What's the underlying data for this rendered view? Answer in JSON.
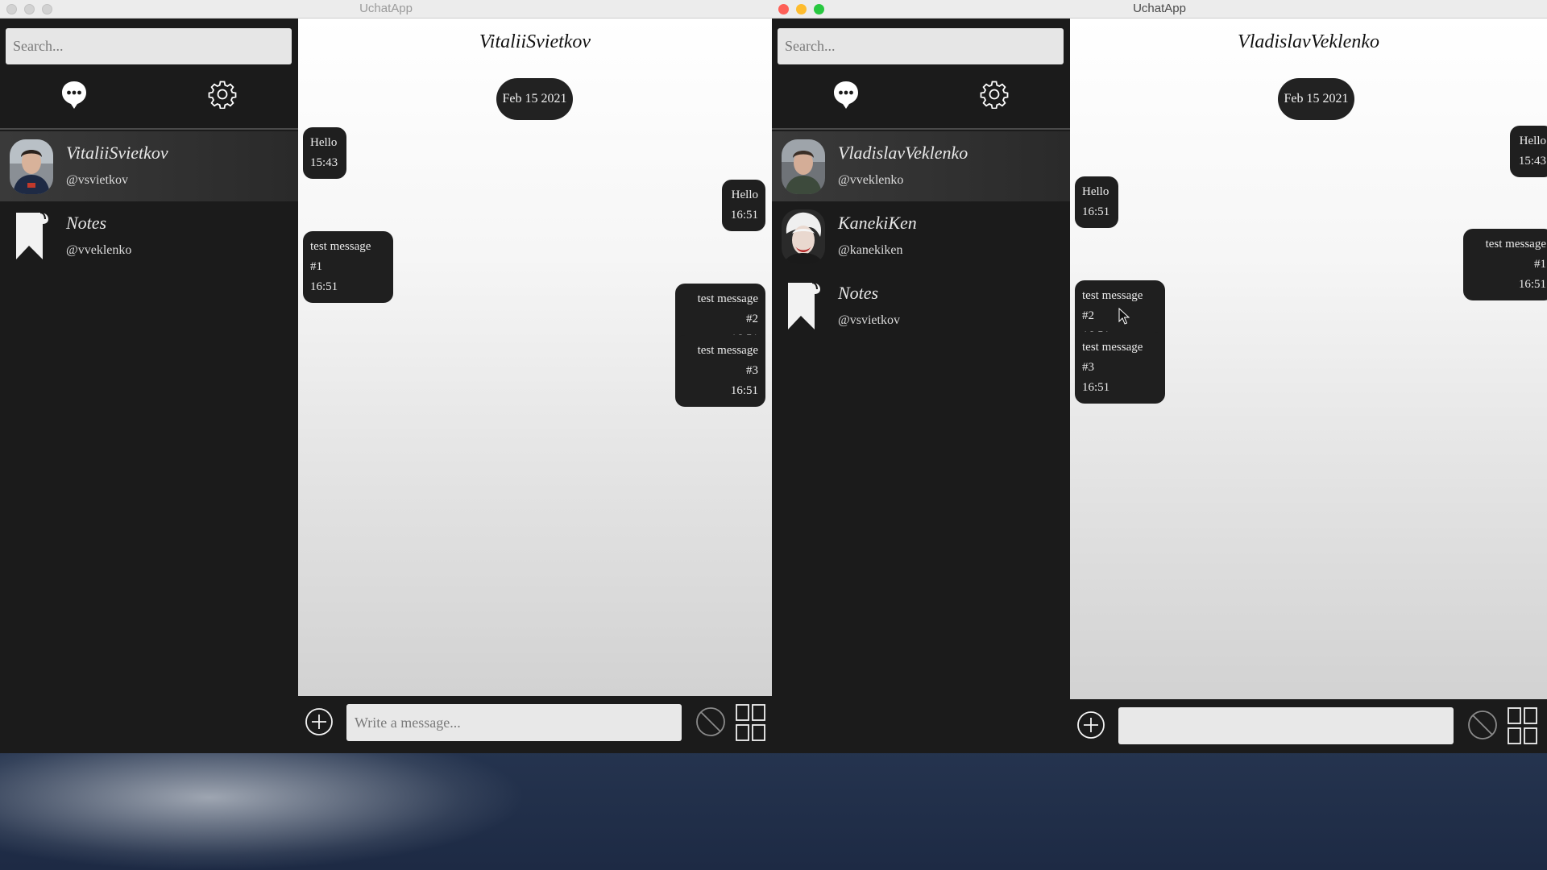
{
  "app": {
    "title": "UchatApp"
  },
  "left_window": {
    "search_placeholder": "Search...",
    "contacts": [
      {
        "name": "VitaliiSvietkov",
        "handle": "@vsvietkov",
        "avatar": "person-avatar-1"
      },
      {
        "name": "Notes",
        "handle": "@vveklenko",
        "avatar": "bookmark-icon"
      }
    ],
    "chat_title": "VitaliiSvietkov",
    "date": "Feb 15 2021",
    "messages": [
      {
        "text": "Hello",
        "time": "15:43",
        "dir": "in"
      },
      {
        "text": "Hello",
        "time": "16:51",
        "dir": "out"
      },
      {
        "text": "test message #1",
        "time": "16:51",
        "dir": "in"
      },
      {
        "text": "test message #2",
        "time": "16:51",
        "dir": "out"
      },
      {
        "text": "test message #3",
        "time": "16:51",
        "dir": "out"
      }
    ],
    "composer_placeholder": "Write a message...",
    "composer_value": ""
  },
  "right_window": {
    "search_placeholder": "Search...",
    "contacts": [
      {
        "name": "VladislavVeklenko",
        "handle": "@vveklenko",
        "avatar": "person-avatar-2"
      },
      {
        "name": "KanekiKen",
        "handle": "@kanekiken",
        "avatar": "person-avatar-3"
      },
      {
        "name": "Notes",
        "handle": "@vsvietkov",
        "avatar": "bookmark-icon"
      }
    ],
    "chat_title": "VladislavVeklenko",
    "date": "Feb 15 2021",
    "messages": [
      {
        "text": "Hello",
        "time": "15:43",
        "dir": "out"
      },
      {
        "text": "Hello",
        "time": "16:51",
        "dir": "in"
      },
      {
        "text": "test message #1",
        "time": "16:51",
        "dir": "out"
      },
      {
        "text": "test message #2",
        "time": "16:51",
        "dir": "in"
      },
      {
        "text": "test message #3",
        "time": "16:51",
        "dir": "in"
      }
    ],
    "composer_placeholder": "",
    "composer_value": ""
  },
  "colors": {
    "sidebar": "#1b1b1b",
    "bubble": "#1f1f1f",
    "traffic_red": "#fe5f57",
    "traffic_yellow": "#febc2e",
    "traffic_green": "#28c840"
  }
}
